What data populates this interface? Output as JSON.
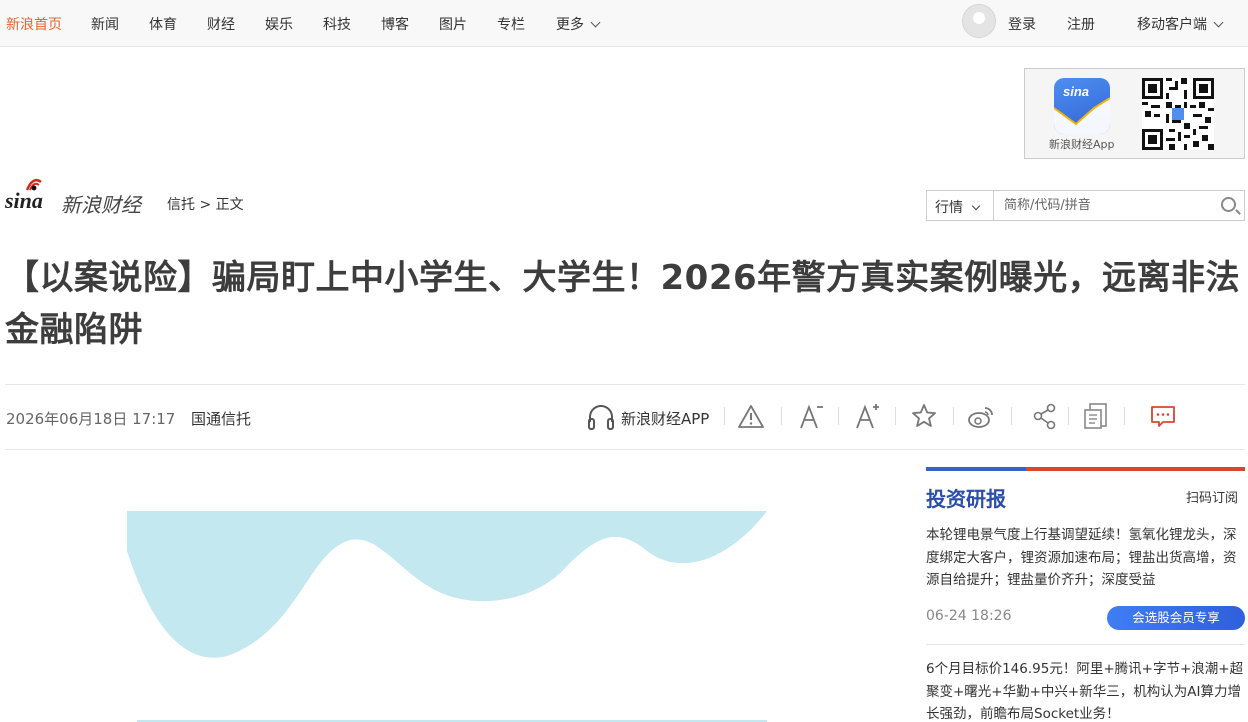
{
  "nav": {
    "items": [
      "新浪首页",
      "新闻",
      "体育",
      "财经",
      "娱乐",
      "科技",
      "博客",
      "图片",
      "专栏",
      "更多"
    ],
    "login": "登录",
    "register": "注册",
    "mobile": "移动客户端"
  },
  "app_promo": {
    "label": "新浪财经App",
    "icon_text": "sina"
  },
  "logo": {
    "sina": "sina",
    "brand": "新浪财经"
  },
  "breadcrumb": {
    "section": "信托",
    "separator": ">",
    "current": "正文"
  },
  "search": {
    "select_value": "行情",
    "placeholder": "简称/代码/拼音"
  },
  "article": {
    "title": "【以案说险】骗局盯上中小学生、大学生！2026年警方真实案例曝光，远离非法金融陷阱",
    "date": "2026年06月18日 17:17",
    "source": "国通信托",
    "app_label": "新浪财经APP"
  },
  "sidebar": {
    "title": "投资研报",
    "subscribe": "扫码订阅",
    "items": [
      {
        "text": "本轮锂电景气度上行基调望延续！氢氧化锂龙头，深度绑定大客户，锂资源加速布局；锂盐出货高增，资源自给提升；锂盐量价齐升；深度受益",
        "time": "06-24 18:26",
        "button": "会选股会员专享"
      },
      {
        "text": "6个月目标价146.95元！阿里+腾讯+字节+浪潮+超聚变+曙光+华勤+中兴+新华三，机构认为AI算力增长强劲，前瞻布局Socket业务！"
      }
    ]
  },
  "colors": {
    "home_link": "#e8642f",
    "sidebar_title": "#2b4ea8",
    "bar_blue": "#3b60c7",
    "bar_red": "#d94630",
    "comment_icon": "#d94630",
    "image_wave": "#c4e8ef"
  },
  "icons": [
    "headphones-icon",
    "warning-icon",
    "font-decrease-icon",
    "font-increase-icon",
    "star-icon",
    "weibo-icon",
    "share-icon",
    "print-icon",
    "comment-icon",
    "search-icon",
    "chevron-down-icon",
    "qr-code-icon"
  ]
}
